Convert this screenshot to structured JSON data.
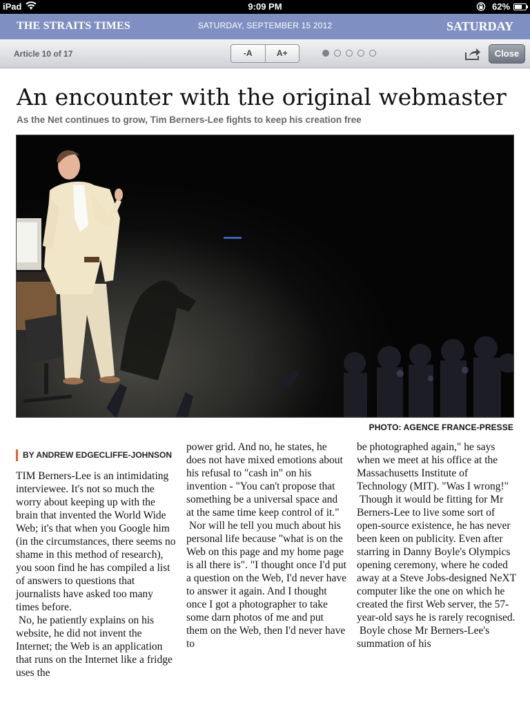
{
  "status_bar": {
    "device": "iPad",
    "time": "9:09 PM",
    "battery": "62%"
  },
  "masthead": {
    "logo": "THE STRAITS TIMES",
    "date": "SATURDAY, SEPTEMBER 15 2012",
    "day": "SATURDAY"
  },
  "toolbar": {
    "article_count": "Article 10 of 17",
    "font_decrease": "-A",
    "font_increase": "A+",
    "page_dots": 5,
    "active_dot": 1,
    "close_label": "Close"
  },
  "article": {
    "headline": "An encounter with the original webmaster",
    "subhead": "As the Net continues to grow, Tim Berners-Lee fights to keep his creation free",
    "photo_credit": "PHOTO: AGENCE FRANCE-PRESSE",
    "byline": "BY ANDREW EDGECLIFFE-JOHNSON",
    "col1": [
      "TIM Berners-Lee is an intimidating interviewee. It's not so much the worry about keeping up with the brain that invented the World Wide Web; it's that when you Google him (in the circumstances, there seems no shame in this method of research), you soon find he has compiled a list of answers to questions that journalists have asked too many times before.",
      " No, he patiently explains on his website, he did not invent the Internet; the Web is an application that runs on the Internet like a fridge uses the"
    ],
    "col2": [
      "power grid. And no, he states, he does not have mixed emotions about his refusal to \"cash in\" on his invention - \"You can't propose that something be a universal space and at the same time keep control of it.\"",
      " Nor will he tell you much about his personal life because \"what is on the Web on this page and my home page is all there is\". \"I thought once I'd put a question on the Web, I'd never have to answer it again. And I thought once I got a photographer to take some darn photos of me and put them on the Web, then I'd never have to"
    ],
    "col3": [
      "be photographed again,\" he says when we meet at his office at the Massachusetts Institute of Technology (MIT). \"Was I wrong!\"",
      " Though it would be fitting for Mr Berners-Lee to live some sort of open-source existence, he has never been keen on publicity. Even after starring in Danny Boyle's Olympics opening ceremony, where he coded away at a Steve Jobs-designed NeXT computer like the one on which he created the first Web server, the 57-year-old says he is rarely recognised.",
      " Boyle chose Mr Berners-Lee's summation of his"
    ]
  },
  "colors": {
    "masthead": "#7f8fc1",
    "byline_accent": "#e0622a"
  }
}
